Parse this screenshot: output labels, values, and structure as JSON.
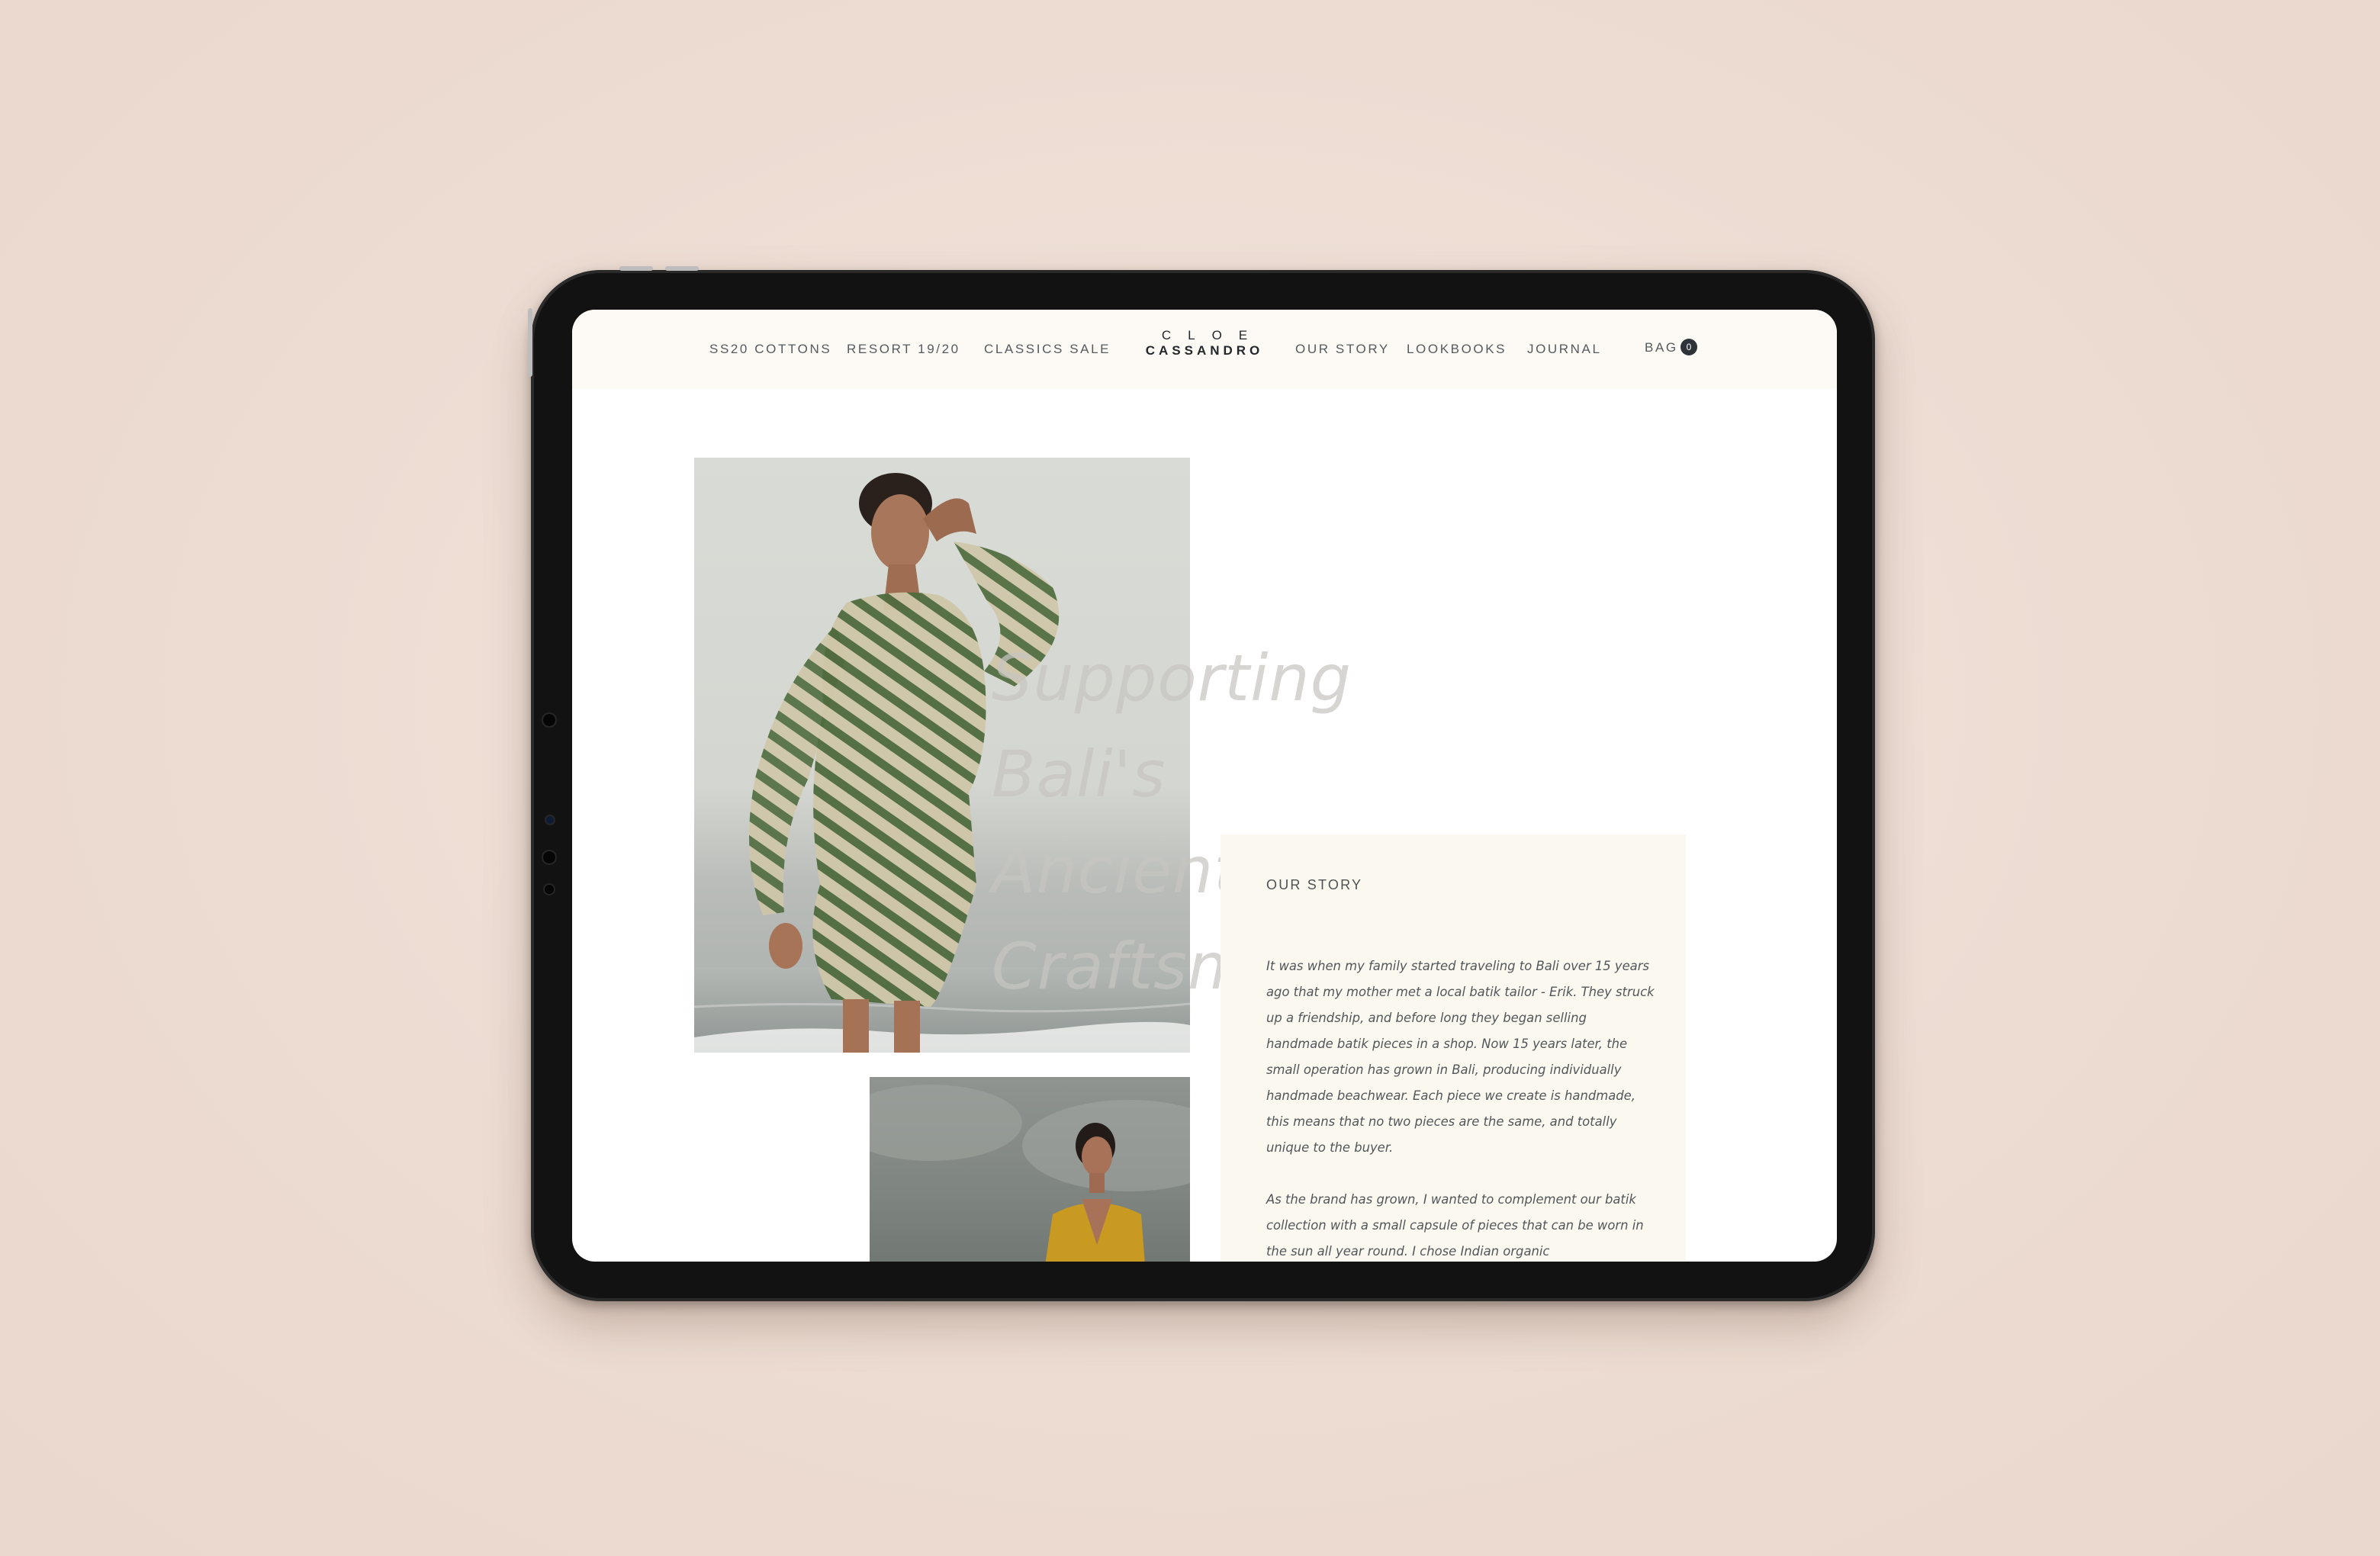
{
  "colors": {
    "background": "#eddcd2",
    "nav_background": "#fdfaf6",
    "card_background": "#fbf8ef",
    "text": "#555a5e",
    "badge": "#2d3338"
  },
  "nav": {
    "left_links": [
      "SS20 COTTONS",
      "RESORT 19/20",
      "CLASSICS SALE"
    ],
    "logo_line1": "CLOE",
    "logo_line2": "CASSANDRO",
    "right_links": [
      "OUR STORY",
      "LOOKBOOKS",
      "JOURNAL"
    ],
    "bag_label": "BAG",
    "bag_count": "0"
  },
  "hero": {
    "title_line1": "Supporting Bali's",
    "title_line2": "Ancient Craftsmen"
  },
  "story": {
    "heading": "OUR STORY",
    "paragraph1": "It was when my family started traveling to Bali over 15 years ago that my mother met a local batik tailor - Erik. They struck up a friendship, and before long they began selling handmade batik pieces in a shop. Now 15 years later, the small operation has grown in Bali, producing individually handmade beachwear. Each piece we create is handmade, this means that no two pieces are the same, and totally unique to the buyer.",
    "paragraph2": "As the brand has grown, I wanted to complement our batik collection with a small capsule of pieces that can be worn in the sun all year round. I chose Indian organic"
  },
  "images": {
    "main_photo": "model-green-zebra-wrap-dress-beach",
    "second_photo": "model-yellow-silk-dress-sky"
  }
}
